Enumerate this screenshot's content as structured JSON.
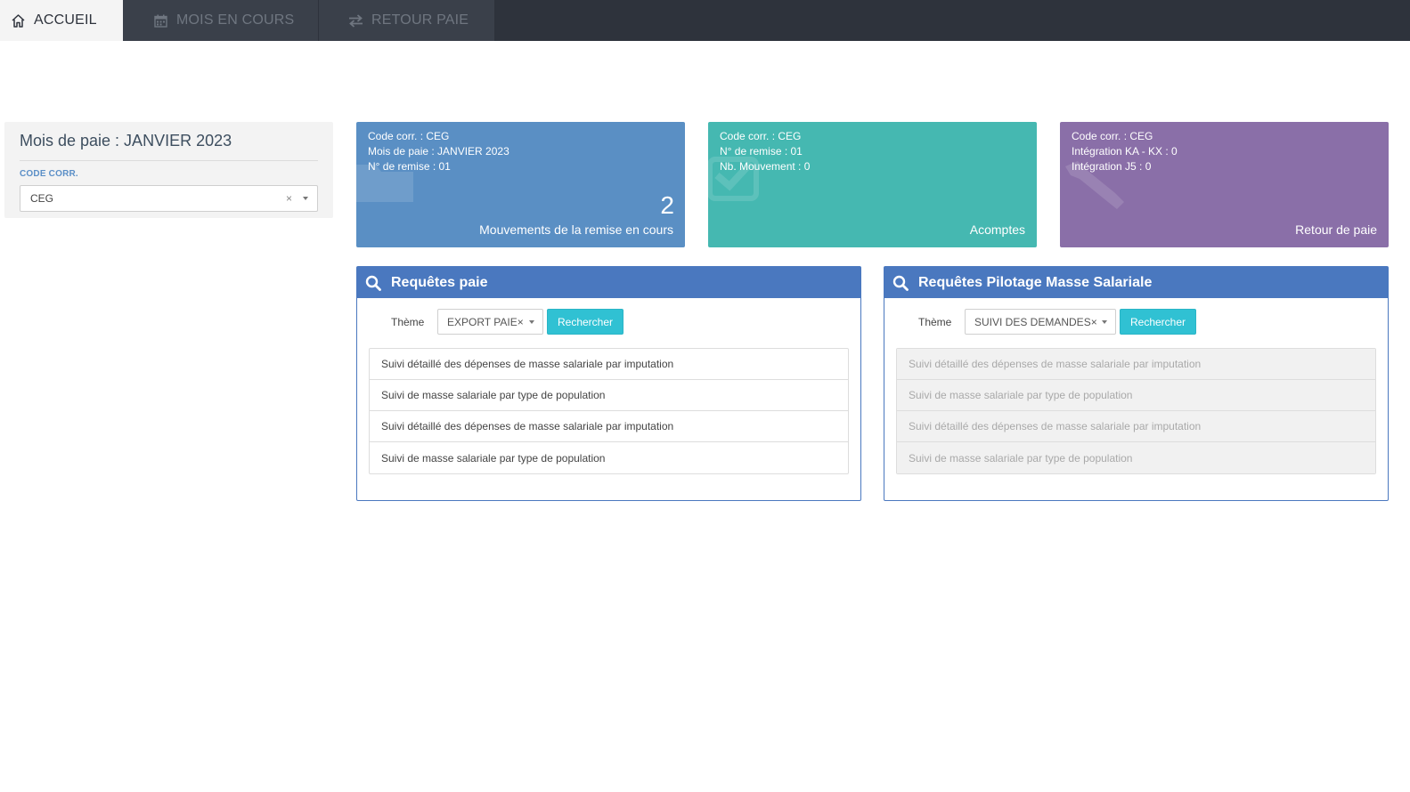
{
  "nav": {
    "tabs": [
      {
        "label": "ACCUEIL",
        "icon": "home-icon",
        "active": true
      },
      {
        "label": "MOIS EN COURS",
        "icon": "calendar-icon",
        "active": false
      },
      {
        "label": "RETOUR PAIE",
        "icon": "exchange-icon",
        "active": false
      }
    ]
  },
  "left_panel": {
    "title": "Mois de paie : JANVIER 2023",
    "code_label": "CODE CORR.",
    "code_value": "CEG",
    "clear_glyph": "×"
  },
  "tiles": [
    {
      "lines": [
        "Code corr. : CEG",
        "Mois de paie : JANVIER 2023",
        "N° de remise : 01"
      ],
      "count": "2",
      "caption": "Mouvements de la remise en cours",
      "color": "#5a8fc4",
      "icon": "folder-icon"
    },
    {
      "lines": [
        "Code corr. : CEG",
        "N° de remise : 01",
        "Nb. Mouvement : 0"
      ],
      "caption": "Acomptes",
      "color": "#45b8b1",
      "icon": "check-icon"
    },
    {
      "lines": [
        "Code corr. : CEG",
        "Intégration KA - KX : 0",
        "Intégration J5 : 0"
      ],
      "caption": "Retour de paie",
      "color": "#8a6fa8",
      "icon": "tool-icon"
    }
  ],
  "query_panels": [
    {
      "title": "Requêtes paie",
      "theme_label": "Thème",
      "theme_value": "EXPORT PAIE×",
      "button": "Rechercher",
      "items": [
        "Suivi détaillé des dépenses de masse salariale par imputation",
        "Suivi de masse salariale par type de population",
        "Suivi détaillé des dépenses de masse salariale par imputation",
        "Suivi de masse salariale par type de population"
      ]
    },
    {
      "title": "Requêtes Pilotage Masse Salariale",
      "theme_label": "Thème",
      "theme_value": "SUIVI DES DEMANDES×",
      "button": "Rechercher",
      "items": [
        "Suivi détaillé des dépenses de masse salariale par imputation",
        "Suivi de masse salariale par type de population",
        "Suivi détaillé des dépenses de masse salariale par imputation",
        "Suivi de masse salariale par type de population"
      ]
    }
  ],
  "colors": {
    "nav_bg": "#2e333c",
    "panel_header": "#4a78bf",
    "button": "#30c1d3"
  }
}
